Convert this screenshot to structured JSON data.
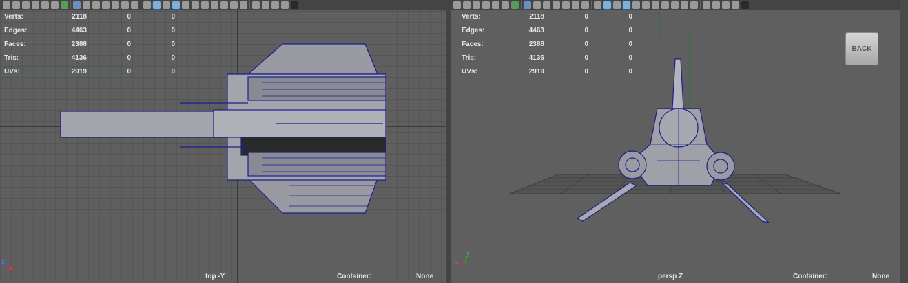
{
  "left_viewport": {
    "hud": [
      {
        "label": "Verts:",
        "v1": "2118",
        "v2": "0",
        "v3": "0"
      },
      {
        "label": "Edges:",
        "v1": "4463",
        "v2": "0",
        "v3": "0"
      },
      {
        "label": "Faces:",
        "v1": "2388",
        "v2": "0",
        "v3": "0"
      },
      {
        "label": "Tris:",
        "v1": "4136",
        "v2": "0",
        "v3": "0"
      },
      {
        "label": "UVs:",
        "v1": "2919",
        "v2": "0",
        "v3": "0"
      }
    ],
    "camera": "top -Y",
    "container_label": "Container:",
    "container_value": "None",
    "axis_x": "x",
    "axis_z": "z"
  },
  "right_viewport": {
    "hud": [
      {
        "label": "Verts:",
        "v1": "2118",
        "v2": "0",
        "v3": "0"
      },
      {
        "label": "Edges:",
        "v1": "4463",
        "v2": "0",
        "v3": "0"
      },
      {
        "label": "Faces:",
        "v1": "2388",
        "v2": "0",
        "v3": "0"
      },
      {
        "label": "Tris:",
        "v1": "4136",
        "v2": "0",
        "v3": "0"
      },
      {
        "label": "UVs:",
        "v1": "2919",
        "v2": "0",
        "v3": "0"
      }
    ],
    "camera": "persp Z",
    "container_label": "Container:",
    "container_value": "None",
    "back_button": "BACK",
    "axis_x": "x",
    "axis_y": "y"
  },
  "colors": {
    "viewport_bg": "#5f5f5f",
    "wireframe": "#1a1f8c",
    "mesh_fill": "#a0a0a8",
    "grid": "#4a4a4a"
  }
}
